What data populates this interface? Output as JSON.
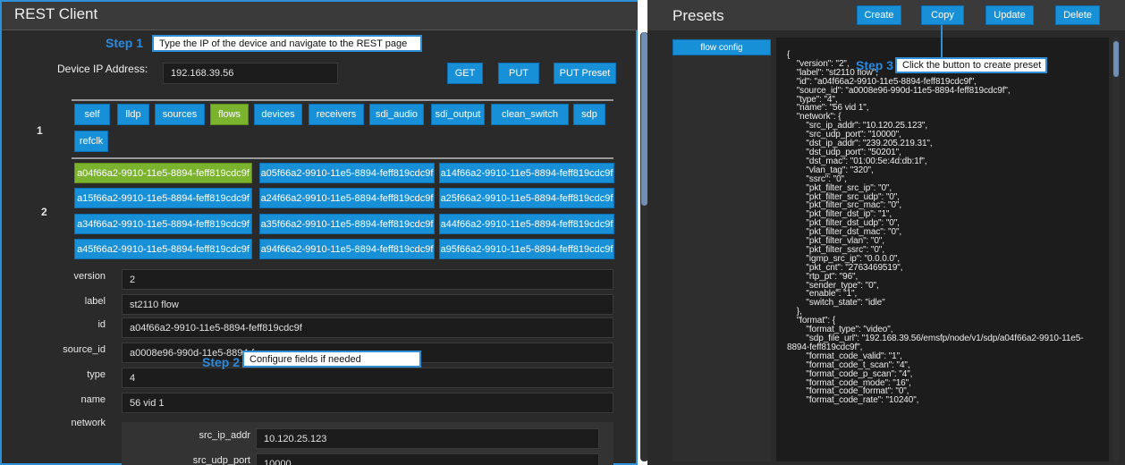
{
  "rest": {
    "title": "REST Client",
    "device_ip_label": "Device IP Address:",
    "device_ip_value": "192.168.39.56",
    "buttons": {
      "get": "GET",
      "put": "PUT",
      "put_preset": "PUT Preset"
    },
    "row1_number": "1",
    "row2_number": "2",
    "endpoints": [
      "self",
      "lldp",
      "sources",
      "flows",
      "devices",
      "receivers",
      "sdi_audio",
      "sdi_output",
      "clean_switch",
      "sdp",
      "refclk"
    ],
    "active_endpoint": "flows",
    "flows": [
      "a04f66a2-9910-11e5-8894-feff819cdc9f",
      "a05f66a2-9910-11e5-8894-feff819cdc9f",
      "a14f66a2-9910-11e5-8894-feff819cdc9f",
      "a15f66a2-9910-11e5-8894-feff819cdc9f",
      "a24f66a2-9910-11e5-8894-feff819cdc9f",
      "a25f66a2-9910-11e5-8894-feff819cdc9f",
      "a34f66a2-9910-11e5-8894-feff819cdc9f",
      "a35f66a2-9910-11e5-8894-feff819cdc9f",
      "a44f66a2-9910-11e5-8894-feff819cdc9f",
      "a45f66a2-9910-11e5-8894-feff819cdc9f",
      "a94f66a2-9910-11e5-8894-feff819cdc9f",
      "a95f66a2-9910-11e5-8894-feff819cdc9f"
    ],
    "active_flow": "a04f66a2-9910-11e5-8894-feff819cdc9f",
    "fields": [
      {
        "label": "version",
        "value": "2"
      },
      {
        "label": "label",
        "value": "st2110 flow"
      },
      {
        "label": "id",
        "value": "a04f66a2-9910-11e5-8894-feff819cdc9f"
      },
      {
        "label": "source_id",
        "value": "a0008e96-990d-11e5-8894-fe"
      },
      {
        "label": "type",
        "value": "4"
      },
      {
        "label": "name",
        "value": "56 vid 1"
      }
    ],
    "network_label": "network",
    "network_fields": [
      {
        "label": "src_ip_addr",
        "value": "10.120.25.123"
      },
      {
        "label": "src_udp_port",
        "value": "10000"
      }
    ],
    "callouts": {
      "step1_label": "Step 1",
      "step1_text": "Type the IP of the device and navigate to the REST page",
      "step2_label": "Step 2",
      "step2_text": "Configure fields if needed",
      "step3_label": "Step 3",
      "step3_text": "Click the button to create preset"
    }
  },
  "presets": {
    "title": "Presets",
    "buttons": {
      "create": "Create",
      "copy": "Copy",
      "update": "Update",
      "delete": "Delete"
    },
    "items": [
      "flow config"
    ],
    "json_lines": [
      "{",
      "    \"version\": \"2\",",
      "    \"label\": \"st2110 flow\",",
      "    \"id\": \"a04f66a2-9910-11e5-8894-feff819cdc9f\",",
      "    \"source_id\": \"a0008e96-990d-11e5-8894-feff819cdc9f\",",
      "    \"type\": \"4\",",
      "    \"name\": \"56 vid 1\",",
      "    \"network\": {",
      "        \"src_ip_addr\": \"10.120.25.123\",",
      "        \"src_udp_port\": \"10000\",",
      "        \"dst_ip_addr\": \"239.205.219.31\",",
      "        \"dst_udp_port\": \"50201\",",
      "        \"dst_mac\": \"01:00:5e:4d:db:1f\",",
      "        \"vlan_tag\": \"320\",",
      "        \"ssrc\": \"0\",",
      "        \"pkt_filter_src_ip\": \"0\",",
      "        \"pkt_filter_src_udp\": \"0\",",
      "        \"pkt_filter_src_mac\": \"0\",",
      "        \"pkt_filter_dst_ip\": \"1\",",
      "        \"pkt_filter_dst_udp\": \"0\",",
      "        \"pkt_filter_dst_mac\": \"0\",",
      "        \"pkt_filter_vlan\": \"0\",",
      "        \"pkt_filter_ssrc\": \"0\",",
      "        \"igmp_src_ip\": \"0.0.0.0\",",
      "        \"pkt_cnt\": \"2763469519\",",
      "        \"rtp_pt\": \"96\",",
      "        \"sender_type\": \"0\",",
      "        \"enable\": \"1\",",
      "        \"switch_state\": \"idle\"",
      "    },",
      "    \"format\": {",
      "        \"format_type\": \"video\",",
      "        \"sdp_file_url\": \"192.168.39.56/emsfp/node/v1/sdp/a04f66a2-9910-11e5-",
      "8894-feff819cdc9f\",",
      "        \"format_code_valid\": \"1\",",
      "        \"format_code_t_scan\": \"4\",",
      "        \"format_code_p_scan\": \"4\",",
      "        \"format_code_mode\": \"16\",",
      "        \"format_code_format\": \"0\",",
      "        \"format_code_rate\": \"10240\","
    ]
  },
  "colors": {
    "accent": "#1890d8",
    "active": "#7bb32e",
    "panel_bg": "#2a2a2a",
    "callout_border": "#2e8fd6"
  }
}
